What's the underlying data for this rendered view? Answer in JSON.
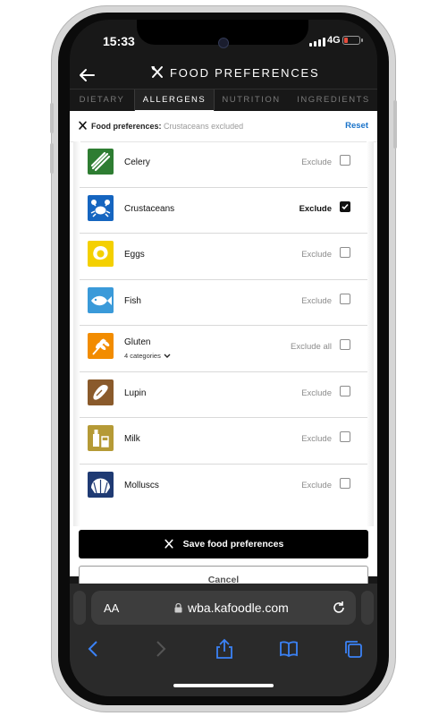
{
  "status_bar": {
    "time": "15:33",
    "network": "4G"
  },
  "header": {
    "title": "FOOD PREFERENCES"
  },
  "tabs": [
    {
      "label": "DIETARY",
      "active": false
    },
    {
      "label": "ALLERGENS",
      "active": true
    },
    {
      "label": "NUTRITION",
      "active": false
    },
    {
      "label": "INGREDIENTS",
      "active": false
    }
  ],
  "preferences_bar": {
    "label": "Food preferences:",
    "value": "Crustaceans excluded",
    "reset_label": "Reset"
  },
  "allergens": [
    {
      "name": "Celery",
      "action": "Exclude",
      "checked": false,
      "icon": "celery-icon",
      "color": "#2e7d32"
    },
    {
      "name": "Crustaceans",
      "action": "Exclude",
      "checked": true,
      "icon": "crab-icon",
      "color": "#1565c0"
    },
    {
      "name": "Eggs",
      "action": "Exclude",
      "checked": false,
      "icon": "egg-icon",
      "color": "#f4d000"
    },
    {
      "name": "Fish",
      "action": "Exclude",
      "checked": false,
      "icon": "fish-icon",
      "color": "#3a9ad9"
    },
    {
      "name": "Gluten",
      "sub": "4 categories",
      "action": "Exclude all",
      "checked": false,
      "icon": "wheat-icon",
      "color": "#f28c00"
    },
    {
      "name": "Lupin",
      "action": "Exclude",
      "checked": false,
      "icon": "lupin-icon",
      "color": "#8a5a2b"
    },
    {
      "name": "Milk",
      "action": "Exclude",
      "checked": false,
      "icon": "milk-icon",
      "color": "#b59a36"
    },
    {
      "name": "Molluscs",
      "action": "Exclude",
      "checked": false,
      "icon": "shell-icon",
      "color": "#1f3a73"
    }
  ],
  "buttons": {
    "save": "Save food preferences",
    "cancel": "Cancel"
  },
  "browser": {
    "text_size": "AA",
    "url": "wba.kafoodle.com"
  },
  "colors": {
    "header_bg": "#181818",
    "link": "#1a73c9",
    "browser_icons": "#3b82f6"
  }
}
